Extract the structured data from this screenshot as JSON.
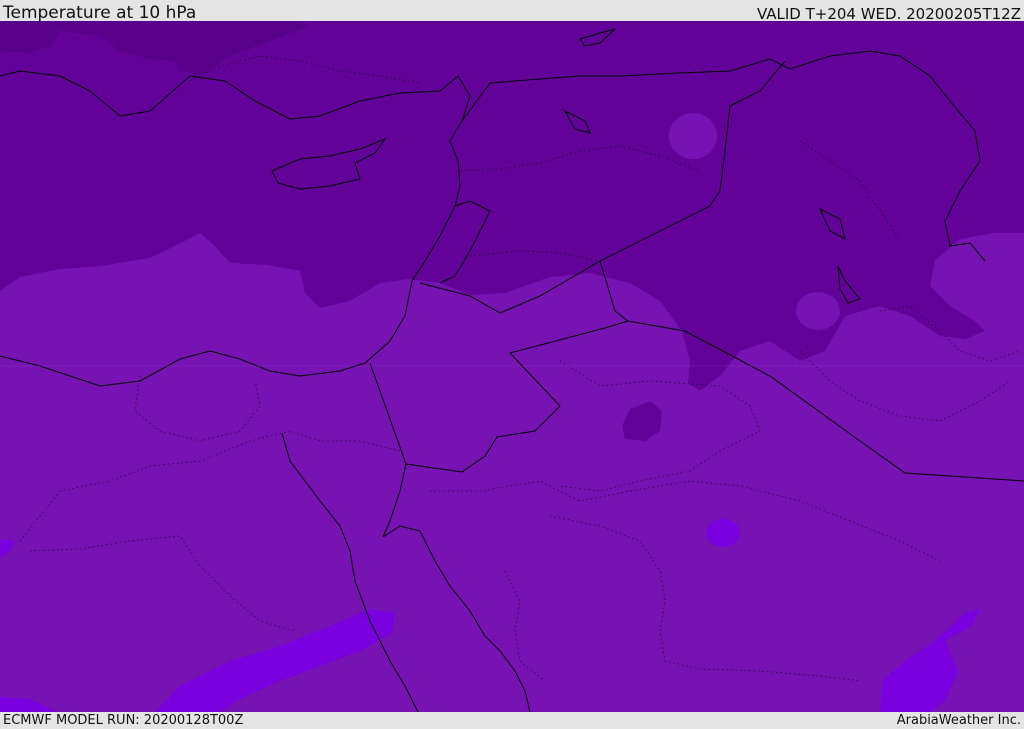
{
  "header": {
    "title": "Temperature at 10 hPa",
    "valid_time": "VALID T+204 WED. 20200205T12Z"
  },
  "footer": {
    "model_run": "ECMWF MODEL RUN: 20200128T00Z",
    "credit": "ArabiaWeather Inc."
  },
  "colors": {
    "cold_band": "#620299",
    "mid_band": "#7713b3",
    "warm_band": "#7a00e0",
    "darkest_band": "#57008a",
    "coastline": "#000000"
  }
}
